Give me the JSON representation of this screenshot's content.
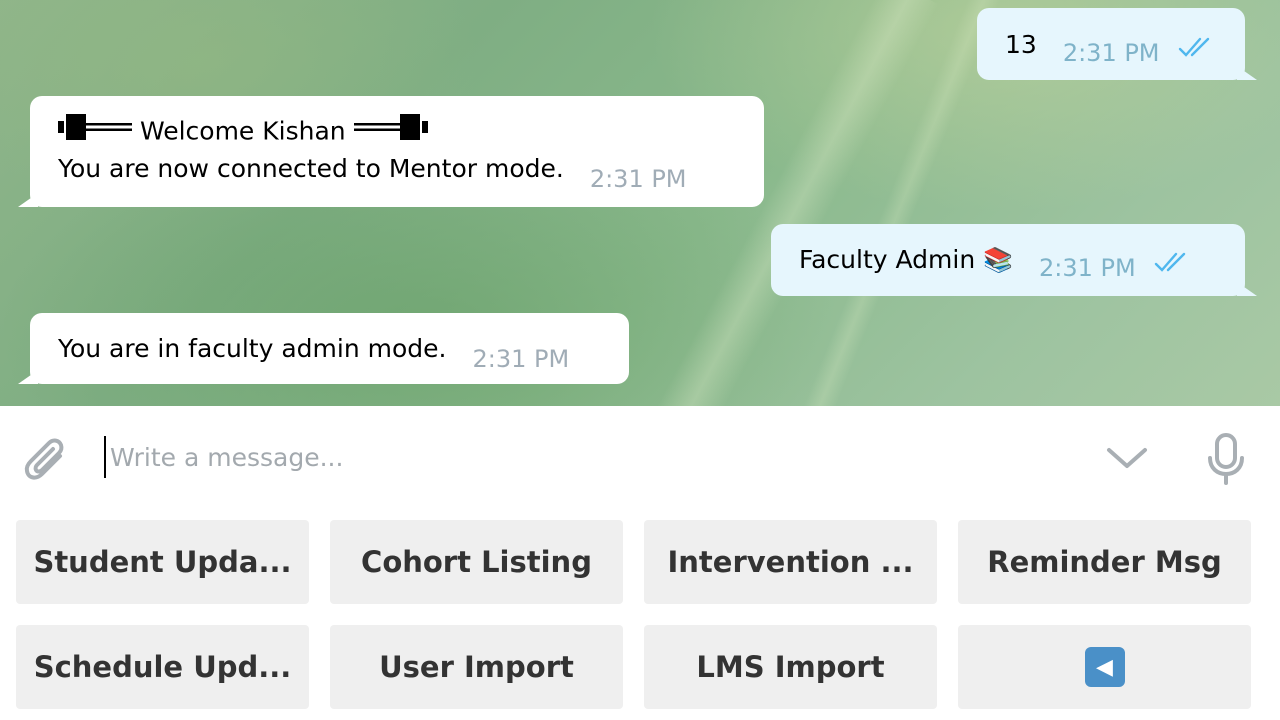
{
  "messages": [
    {
      "id": "m1",
      "direction": "out",
      "text": "13",
      "time": "2:31 PM",
      "status": "read"
    },
    {
      "id": "m2",
      "direction": "in",
      "line1": "Welcome Kishan",
      "line2": "You are now connected to Mentor mode.",
      "time": "2:31 PM"
    },
    {
      "id": "m3",
      "direction": "out",
      "text": "Faculty Admin",
      "emoji": "📚",
      "time": "2:31 PM",
      "status": "read"
    },
    {
      "id": "m4",
      "direction": "in",
      "text": "You are in faculty admin mode.",
      "time": "2:31 PM"
    }
  ],
  "composer": {
    "placeholder": "Write a message...",
    "value": ""
  },
  "keyboard": {
    "rows": [
      [
        "Student Upda...",
        "Cohort Listing",
        "Intervention ...",
        "Reminder Msg"
      ],
      [
        "Schedule Upd...",
        "User Import",
        "LMS Import",
        "◀"
      ]
    ]
  },
  "colors": {
    "incoming_bubble": "#ffffff",
    "outgoing_bubble": "#e6f6fd",
    "read_check": "#4fb7ee",
    "keyboard_button": "#efefef",
    "back_button": "#4a90c8"
  },
  "icons": {
    "attach": "paperclip-icon",
    "chevron": "chevron-down-icon",
    "mic": "microphone-icon",
    "read": "double-check-icon",
    "dumbbell": "dumbbell-icon",
    "back": "back-arrow-icon"
  }
}
